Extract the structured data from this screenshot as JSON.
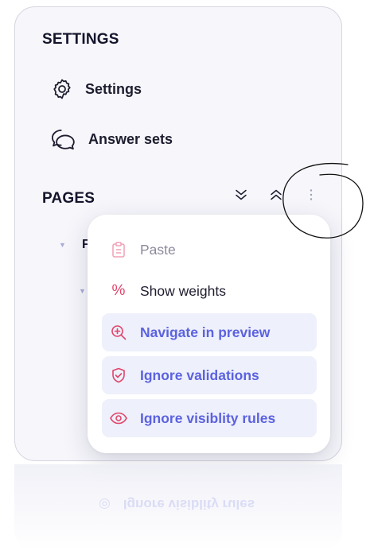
{
  "settings_section": {
    "title": "SETTINGS",
    "items": [
      {
        "label": "Settings",
        "icon": "gear-icon"
      },
      {
        "label": "Answer sets",
        "icon": "chat-bubbles-icon"
      }
    ]
  },
  "pages_section": {
    "title": "PAGES",
    "tools": [
      {
        "icon": "collapse-all-icon"
      },
      {
        "icon": "expand-all-icon"
      },
      {
        "icon": "more-vertical-icon"
      }
    ],
    "tree": [
      {
        "label": "F",
        "level": 1
      },
      {
        "label": "",
        "level": 2
      }
    ]
  },
  "context_menu": {
    "items": [
      {
        "label": "Paste",
        "icon": "clipboard-icon",
        "state": "disabled"
      },
      {
        "label": "Show weights",
        "icon": "percent-icon",
        "state": "normal"
      },
      {
        "label": "Navigate in preview",
        "icon": "zoom-in-icon",
        "state": "active"
      },
      {
        "label": "Ignore validations",
        "icon": "shield-check-icon",
        "state": "active"
      },
      {
        "label": "Ignore visiblity rules",
        "icon": "eye-icon",
        "state": "active"
      }
    ]
  },
  "colors": {
    "accent": "#5b62e0",
    "icon_accent": "#e0456b",
    "panel_bg": "#f6f6fb",
    "active_bg": "#eef0fb"
  }
}
